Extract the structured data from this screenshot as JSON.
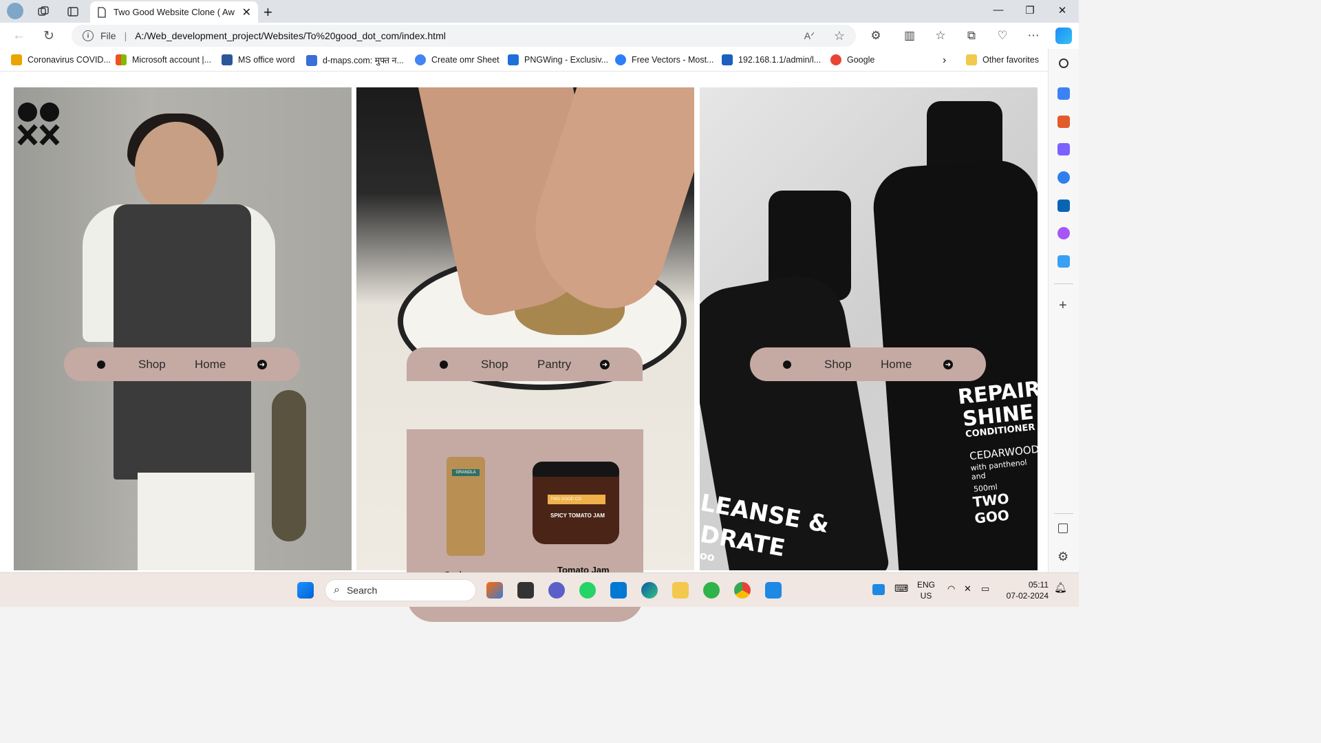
{
  "browser": {
    "tab_title": "Two Good Website Clone ( Awar",
    "address_prefix": "File",
    "url": "A:/Web_development_project/Websites/To%20good_dot_com/index.html",
    "favorites": [
      {
        "label": "Coronavirus COVID...",
        "color": "#e8a400"
      },
      {
        "label": "Microsoft account |...",
        "color": "#f25022"
      },
      {
        "label": "MS office word",
        "color": "#2b579a"
      },
      {
        "label": "d-maps.com: मुफ्त न...",
        "color": "#3a6fd8"
      },
      {
        "label": "Create omr Sheet",
        "color": "#4285f4"
      },
      {
        "label": "PNGWing - Exclusiv...",
        "color": "#1e6fd9"
      },
      {
        "label": "Free Vectors - Most...",
        "color": "#2d7ff9"
      },
      {
        "label": "192.168.1.1/admin/l...",
        "color": "#1b5fbf"
      },
      {
        "label": "Google",
        "color": "#ea4335"
      }
    ],
    "other_favorites": "Other favorites"
  },
  "page": {
    "panels": [
      {
        "menu": {
          "item1": "Shop",
          "item2": "Home"
        }
      },
      {
        "menu": {
          "item1": "Shop",
          "item2": "Pantry"
        }
      },
      {
        "menu": {
          "item1": "Shop",
          "item2": "Home"
        }
      }
    ],
    "dropdown": {
      "products": [
        {
          "name": "Garlonova",
          "label": "GRANOLA"
        },
        {
          "name": "Tomato Jam",
          "brand": "TWO GOOD CO.",
          "label": "SPICY TOMATO JAM"
        }
      ]
    },
    "bottle_text": {
      "line1": "REPAIR",
      "line2": "SHINE",
      "line3": "CONDITIONER",
      "line4": "CEDARWOOD",
      "line5": "with panthenol and",
      "line6": "500ml",
      "line7": "TWO GOO",
      "left1": "LEANSE &",
      "left2": "DRATE",
      "left3": "oo"
    }
  },
  "taskbar": {
    "search_label": "Search",
    "lang1": "ENG",
    "lang2": "US",
    "time": "05:11",
    "date": "07-02-2024"
  },
  "colors": {
    "menu_bg": "#c4aaa3",
    "accent": "#111111"
  }
}
